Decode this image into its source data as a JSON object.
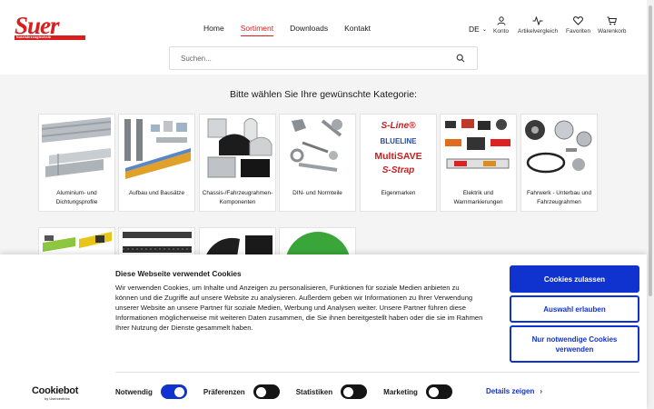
{
  "brand": {
    "logo_text": "Suer",
    "logo_subtext": "Nutzfahrzeugtechnik",
    "color": "#d81e1e"
  },
  "nav": {
    "items": [
      "Home",
      "Sortiment",
      "Downloads",
      "Kontakt"
    ],
    "active": "Sortiment"
  },
  "header": {
    "language": "DE",
    "icons": [
      {
        "label": "Konto",
        "icon": "user-icon"
      },
      {
        "label": "Artikelvergleich",
        "icon": "compare-icon"
      },
      {
        "label": "Favoriten",
        "icon": "heart-icon"
      },
      {
        "label": "Warenkorb",
        "icon": "cart-icon"
      }
    ]
  },
  "search": {
    "placeholder": "Suchen..."
  },
  "main": {
    "heading": "Bitte wählen Sie Ihre gewünschte Kategorie:",
    "categories": [
      {
        "label": "Aluminium- und Dichtungsprofile"
      },
      {
        "label": "Aufbau und Bausätze"
      },
      {
        "label": "Chassis-/Fahrzeugrahmen-Komponenten"
      },
      {
        "label": "DIN- und Normteile"
      },
      {
        "label": "Eigenmarken",
        "brands": [
          "S-Line®",
          "BLUELINE",
          "MultiSAVE",
          "S-Strap"
        ]
      },
      {
        "label": "Elektrik und Warnmarkierungen"
      },
      {
        "label": "Fahrwerk - Unterbau und Fahrzeugrahmen"
      }
    ]
  },
  "cookie_banner": {
    "title": "Diese Webseite verwendet Cookies",
    "text": "Wir verwenden Cookies, um Inhalte und Anzeigen zu personalisieren, Funktionen für soziale Medien anbieten zu können und die Zugriffe auf unsere Website zu analysieren. Außerdem geben wir Informationen zu Ihrer Verwendung unserer Website an unsere Partner für soziale Medien, Werbung und Analysen weiter. Unsere Partner führen diese Informationen möglicherweise mit weiteren Daten zusammen, die Sie ihnen bereitgestellt haben oder die sie im Rahmen Ihrer Nutzung der Dienste gesammelt haben.",
    "buttons": {
      "allow_all": "Cookies zulassen",
      "allow_selection": "Auswahl erlauben",
      "necessary_only": "Nur notwendige Cookies verwenden"
    },
    "toggles": [
      {
        "label": "Notwendig",
        "on": true
      },
      {
        "label": "Präferenzen",
        "on": false
      },
      {
        "label": "Statistiken",
        "on": false
      },
      {
        "label": "Marketing",
        "on": false
      }
    ],
    "details_label": "Details zeigen",
    "provider_logo": "Cookiebot",
    "provider_sub": "by Usercentrics",
    "accent_color": "#1032cf"
  }
}
